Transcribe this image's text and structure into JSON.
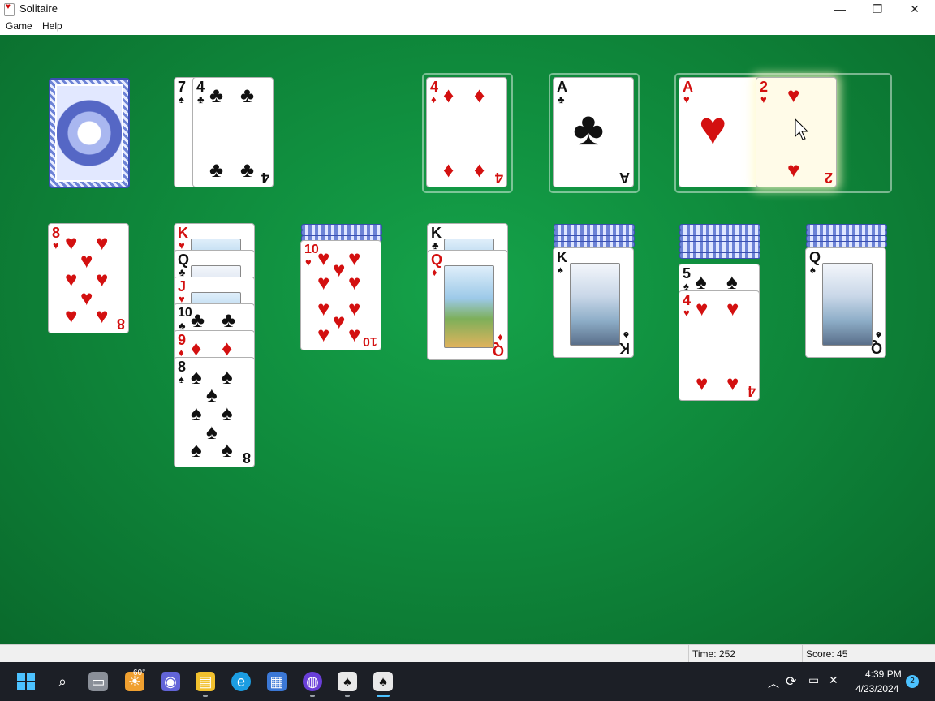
{
  "window": {
    "title": "Solitaire",
    "minimize_icon": "minimize-icon",
    "restore_icon": "restore-icon",
    "close_icon": "close-icon"
  },
  "menu": {
    "game": "Game",
    "help": "Help"
  },
  "cards": {
    "waste_7": {
      "rank": "7",
      "suit": "♠"
    },
    "waste_4": {
      "rank": "4",
      "suit": "♣"
    },
    "found1_4": {
      "rank": "4",
      "suit": "♦"
    },
    "found2_A": {
      "rank": "A",
      "suit": "♣"
    },
    "found3_A": {
      "rank": "A",
      "suit": "♥"
    },
    "found3_2": {
      "rank": "2",
      "suit": "♥"
    },
    "t1_8": {
      "rank": "8",
      "suit": "♥"
    },
    "t2_K": {
      "rank": "K",
      "suit": "♥"
    },
    "t2_Q": {
      "rank": "Q",
      "suit": "♣"
    },
    "t2_J": {
      "rank": "J",
      "suit": "♥"
    },
    "t2_10": {
      "rank": "10",
      "suit": "♣"
    },
    "t2_9": {
      "rank": "9",
      "suit": "♦"
    },
    "t2_8": {
      "rank": "8",
      "suit": "♠"
    },
    "t3_10": {
      "rank": "10",
      "suit": "♥"
    },
    "t4_K": {
      "rank": "K",
      "suit": "♣"
    },
    "t4_Q": {
      "rank": "Q",
      "suit": "♦"
    },
    "t5_K": {
      "rank": "K",
      "suit": "♠"
    },
    "t6_5": {
      "rank": "5",
      "suit": "♠"
    },
    "t6_4": {
      "rank": "4",
      "suit": "♥"
    },
    "t7_Q": {
      "rank": "Q",
      "suit": "♠"
    }
  },
  "status": {
    "time": "Time:  252",
    "score": "Score: 45"
  },
  "taskbar": {
    "weather": "60°",
    "time": "4:39 PM",
    "date": "4/23/2024",
    "notifications": "2"
  },
  "colors": {
    "felt": "#0f8a3c",
    "red_suit": "#d31010",
    "black_suit": "#111111"
  }
}
